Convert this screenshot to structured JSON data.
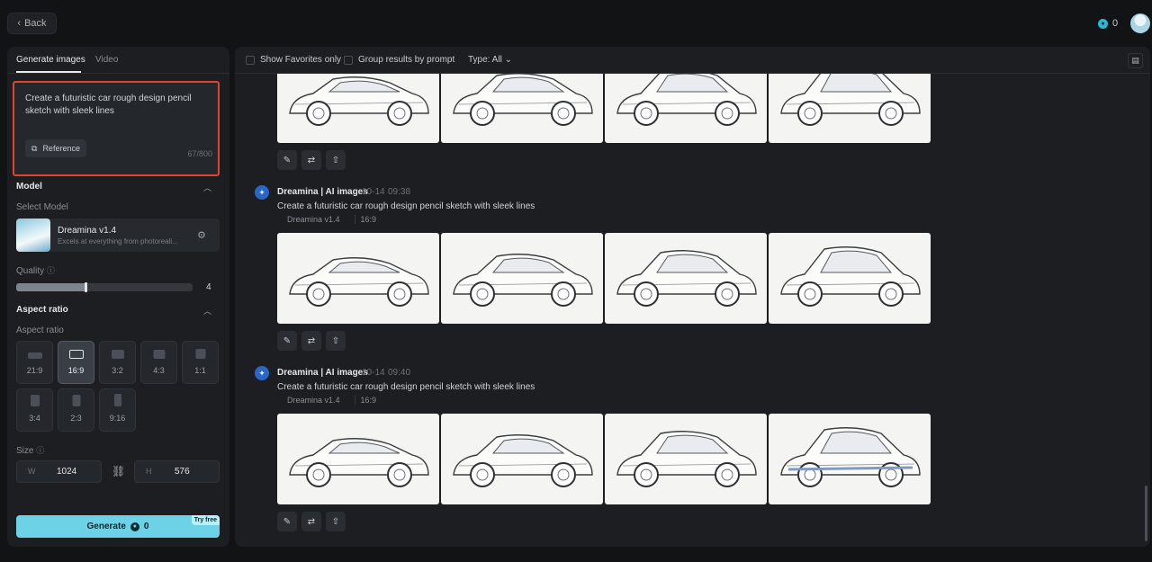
{
  "topbar": {
    "back_label": "Back",
    "credits": "0"
  },
  "tabs": [
    {
      "label": "Generate images"
    },
    {
      "label": "Video"
    }
  ],
  "prompt": {
    "text": "Create a futuristic car rough design pencil sketch with sleek lines",
    "reference_label": "Reference",
    "char_count": "67/800"
  },
  "model": {
    "section_title": "Model",
    "select_label": "Select Model",
    "name": "Dreamina v1.4",
    "description": "Excels at everything from photoreali..."
  },
  "quality": {
    "label": "Quality",
    "value": "4",
    "level_fraction": 0.4
  },
  "aspect": {
    "section_title": "Aspect ratio",
    "sub_label": "Aspect ratio",
    "options": [
      "21:9",
      "16:9",
      "3:2",
      "4:3",
      "1:1",
      "3:4",
      "2:3",
      "9:16"
    ],
    "selected": "16:9"
  },
  "size": {
    "label": "Size",
    "w_letter": "W",
    "width": "1024",
    "h_letter": "H",
    "height": "576"
  },
  "generate": {
    "label": "Generate",
    "cost": "0",
    "badge": "Try free"
  },
  "filters": {
    "favorites": "Show Favorites only",
    "group": "Group results by prompt",
    "type": "Type: All"
  },
  "generations": [
    {
      "title": "Dreamina | AI images",
      "date": "10-14",
      "time": "09:38",
      "prompt": "Create a futuristic car rough design pencil sketch with sleek lines",
      "model": "Dreamina v1.4",
      "ratio": "16:9"
    },
    {
      "title": "Dreamina | AI images",
      "date": "10-14",
      "time": "09:40",
      "prompt": "Create a futuristic car rough design pencil sketch with sleek lines",
      "model": "Dreamina v1.4",
      "ratio": "16:9"
    }
  ],
  "colors": {
    "accent": "#6ed2e6",
    "highlight": "#e0442e"
  }
}
